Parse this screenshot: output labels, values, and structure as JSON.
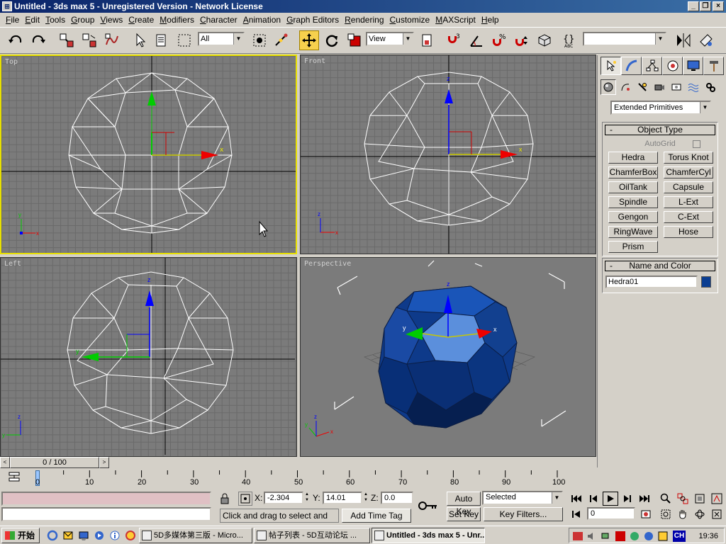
{
  "window": {
    "title": "Untitled - 3ds max 5 - Unregistered Version - Network License",
    "min_glyph": "_",
    "max_glyph": "❐",
    "close_glyph": "×"
  },
  "menu": [
    "File",
    "Edit",
    "Tools",
    "Group",
    "Views",
    "Create",
    "Modifiers",
    "Character",
    "Animation",
    "Graph Editors",
    "Rendering",
    "Customize",
    "MAXScript",
    "Help"
  ],
  "toolbar": {
    "selection_filter": "All",
    "ref_coord": "View",
    "named_selection": ""
  },
  "viewports": {
    "top": "Top",
    "front": "Front",
    "left": "Left",
    "perspective": "Perspective"
  },
  "axis": {
    "x": "x",
    "y": "y",
    "z": "z"
  },
  "command_panel": {
    "category": "Extended Primitives",
    "object_type_title": "Object Type",
    "autogrid": "AutoGrid",
    "buttons": [
      "Hedra",
      "Torus Knot",
      "ChamferBox",
      "ChamferCyl",
      "OilTank",
      "Capsule",
      "Spindle",
      "L-Ext",
      "Gengon",
      "C-Ext",
      "RingWave",
      "Hose",
      "Prism"
    ],
    "name_color_title": "Name and Color",
    "object_name": "Hedra01",
    "object_color": "#0a3d91",
    "minus": "-"
  },
  "timeline": {
    "frame_display": "0 / 100",
    "ticks": [
      "0",
      "10",
      "20",
      "30",
      "40",
      "50",
      "60",
      "70",
      "80",
      "90",
      "100"
    ],
    "left_arrow": "<",
    "right_arrow": ">"
  },
  "status": {
    "x_label": "X:",
    "x_value": "-2.304",
    "y_label": "Y:",
    "y_value": "14.01",
    "z_label": "Z:",
    "z_value": "0.0",
    "prompt": "Click and drag to select and move",
    "add_time_tag": "Add Time Tag",
    "auto_key": "Auto Key",
    "set_key": "Set Key",
    "key_mode": "Selected",
    "key_filters": "Key Filters...",
    "current_frame": "0"
  },
  "taskbar": {
    "start": "开始",
    "tasks": [
      "5D多媒体第三版 - Micro...",
      "帖子列表 - 5D互动论坛 ...",
      "Untitled - 3ds max 5 - Unr..."
    ],
    "tray_ch": "CH",
    "clock": "19:36"
  },
  "colors": {
    "title_bar": "#0a246a",
    "viewport_bg": "#7b7b7b",
    "active_viewport_border": "#e8e000",
    "axis_x": "#ff0000",
    "axis_y": "#00cc00",
    "axis_z": "#0000ff"
  }
}
